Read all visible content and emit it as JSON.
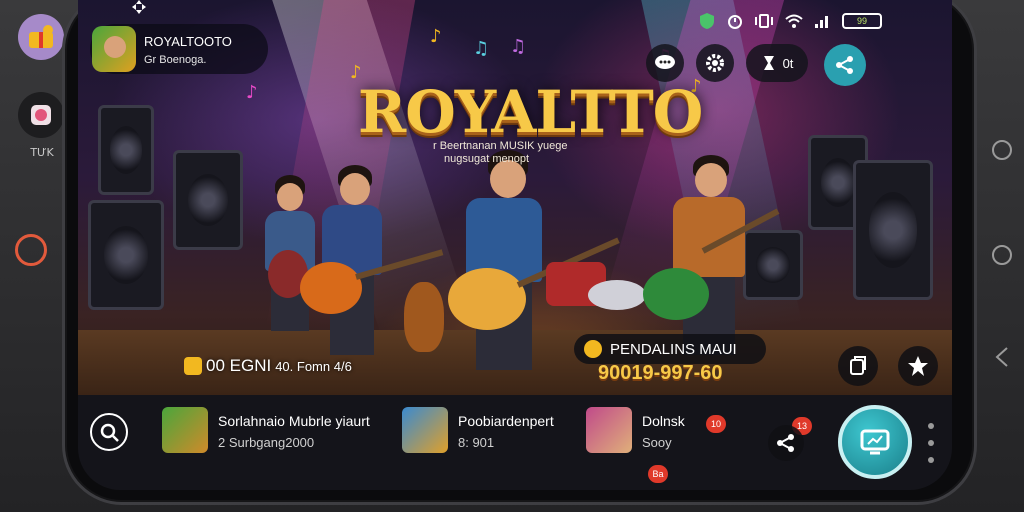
{
  "outer": {
    "left_caption": "TƯK",
    "app_a_icon": "gift-app-icon",
    "app_b_icon": "game-app-icon",
    "record_icon": "record-icon",
    "nav_icons": [
      "home-circle-icon",
      "recent-circle-icon",
      "back-icon"
    ]
  },
  "status_bar": {
    "top_left_icon": "move-icon",
    "icons": [
      "shield-icon",
      "alarm-icon",
      "vibrate-icon",
      "wifi-icon",
      "signal-icon"
    ],
    "battery": "99"
  },
  "profile": {
    "name": "ROYALTOOTO",
    "sub": "Gr Boenoga."
  },
  "top_controls": {
    "chat_icon": "chat-icon",
    "settings_icon": "gear-icon",
    "pill_label": "0t",
    "share_icon": "share-icon"
  },
  "hero": {
    "title": "ROYALTTO",
    "subtitle_line1": "r Beertnanan MUSIK yuege",
    "subtitle_line2": "nugsugat menopt"
  },
  "overlay": {
    "coins_label": "00 EGNI",
    "coins_detail": "40. Fomn 4/6",
    "pending_label": "PENDALINS MAUI",
    "pending_value": "90019-997-60",
    "side_button_1_icon": "copy-icon",
    "side_button_2_icon": "star-icon"
  },
  "bottom_bar": {
    "scan_icon": "scan-icon",
    "cards": [
      {
        "title": "Sorlahnaio Mubrle yiaurt",
        "sub": "2 Surbgang2000"
      },
      {
        "title": "Poobiardenpert",
        "sub": "8: 901"
      },
      {
        "title": "Dolnsk",
        "sub": "Sooy"
      }
    ],
    "badges": [
      "10",
      "13",
      "Ba"
    ],
    "fab_icon": "cast-icon",
    "more_icon": "more-vertical-icon"
  },
  "colors": {
    "accent_gold": "#f7c948",
    "accent_teal": "#2aa0b0",
    "badge_red": "#e0392a"
  }
}
